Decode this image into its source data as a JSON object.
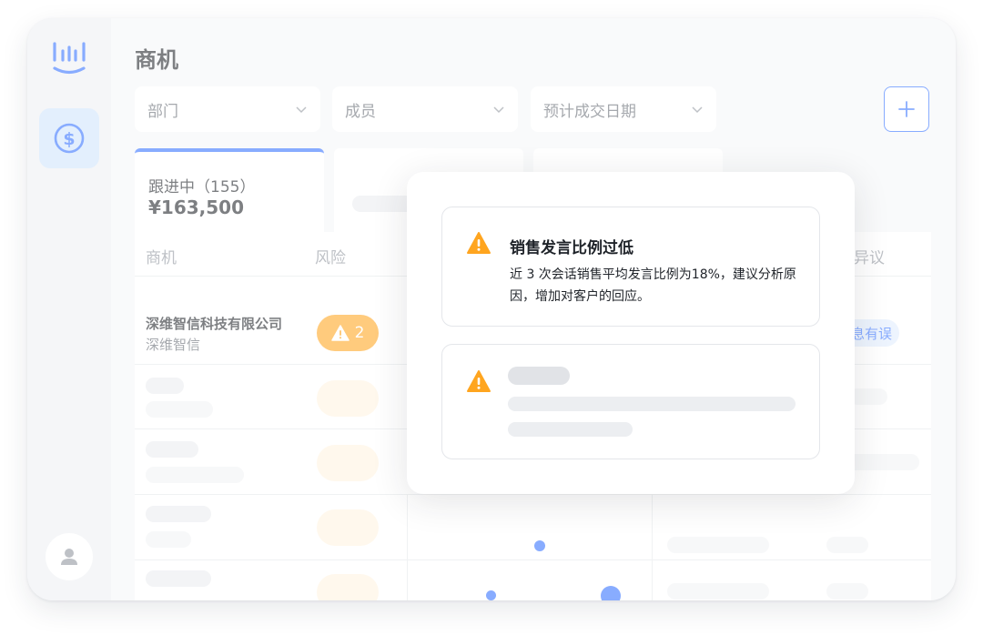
{
  "page": {
    "title": "商机"
  },
  "filters": [
    {
      "label": "部门"
    },
    {
      "label": "成员"
    },
    {
      "label": "预计成交日期"
    }
  ],
  "stage": {
    "label": "跟进中（155）",
    "amount": "¥163,500"
  },
  "table": {
    "columns": {
      "deal": "商机",
      "risk": "风险",
      "objection": "异议"
    },
    "row": {
      "company_name": "深维智信科技有限公司",
      "company_short": "深维智信",
      "risk_count": "2",
      "objection_tag": "息有误"
    }
  },
  "popover": {
    "alerts": [
      {
        "title": "销售发言比例过低",
        "description": "近 3 次会话销售平均发言比例为18%，建议分析原因，增加对客户的回应。"
      }
    ]
  },
  "colors": {
    "accent": "#3370ff",
    "warning": "#ffa51f",
    "nav_active_bg": "#cfe3fb"
  },
  "icons": {
    "logo": "audio-bars-logo",
    "deals": "dollar-circle-icon",
    "user": "user-icon",
    "add": "plus-icon",
    "dropdown": "chevron-down-icon",
    "warning": "warning-triangle-icon"
  }
}
